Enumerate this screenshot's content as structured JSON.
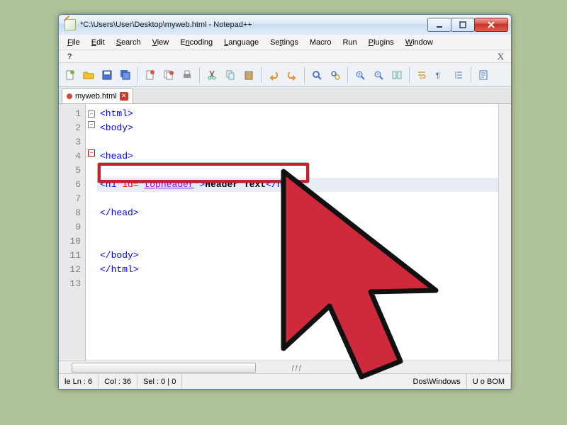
{
  "title": "*C:\\Users\\User\\Desktop\\myweb.html - Notepad++",
  "menus": {
    "file": "File",
    "edit": "Edit",
    "search": "Search",
    "view": "View",
    "encoding": "Encoding",
    "language": "Language",
    "settings": "Settings",
    "macro": "Macro",
    "run": "Run",
    "plugins": "Plugins",
    "window": "Window"
  },
  "question_mark": "?",
  "close_x": "X",
  "tab": {
    "label": "myweb.html"
  },
  "gutter": [
    "1",
    "2",
    "3",
    "4",
    "5",
    "6",
    "7",
    "8",
    "9",
    "10",
    "11",
    "12",
    "13"
  ],
  "code": {
    "l1_open": "<html>",
    "l2_open": "<body>",
    "l4_open": "<head>",
    "l6_tagopen": "<h1 ",
    "l6_attr": "id=",
    "l6_q": "\"",
    "l6_str": "topheader",
    "l6_q2": "\"",
    "l6_tagclose": ">",
    "l6_text": "Header Text",
    "l6_close": "</h1>",
    "l8": "</head>",
    "l11": "</body>",
    "l12": "</html>"
  },
  "status": {
    "line": "le Ln : 6",
    "col": "Col : 36",
    "sel": "Sel : 0 | 0",
    "eol": "Dos\\Windows",
    "enc_partial": "U          o BOM"
  }
}
